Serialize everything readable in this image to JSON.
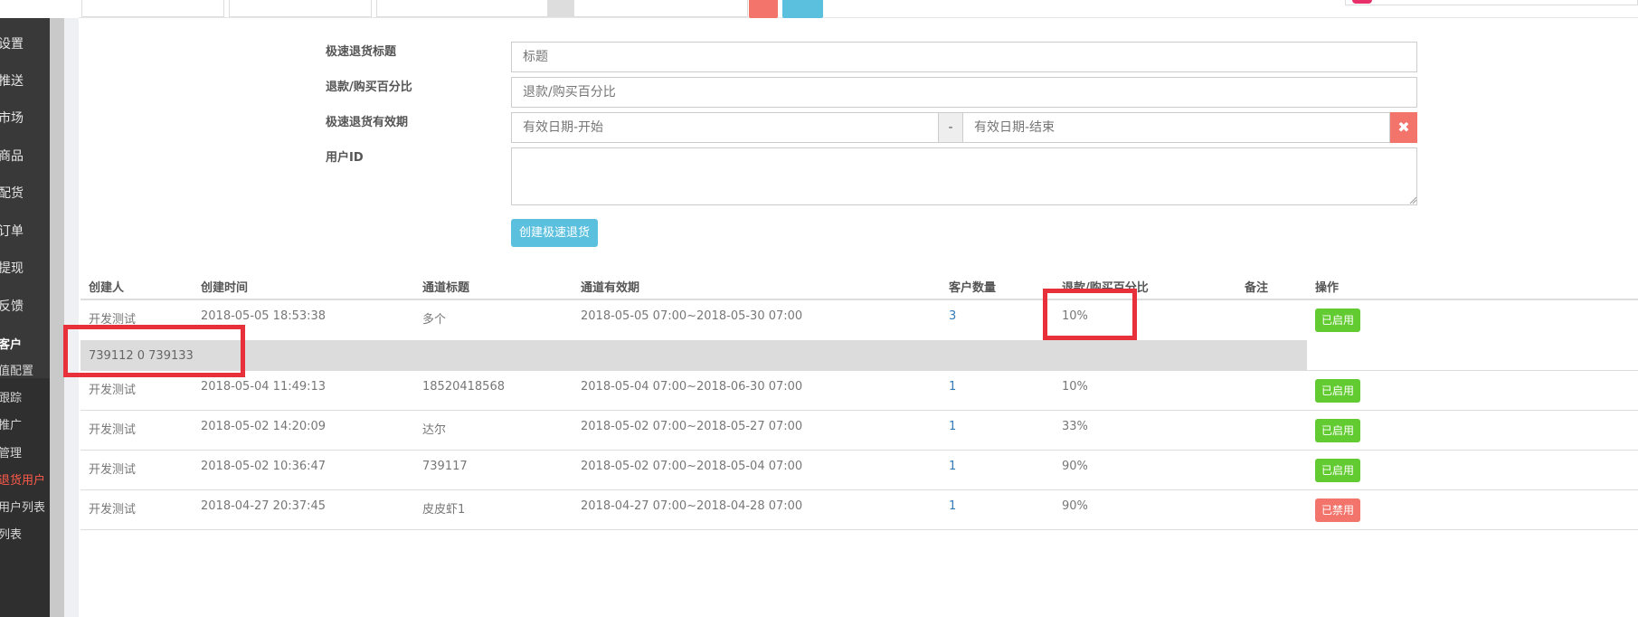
{
  "sidebar": {
    "items": [
      "设置",
      "推送",
      "市场",
      "商品",
      "配货",
      "订单",
      "提现",
      "反馈"
    ],
    "sub_items": [
      {
        "label": "客户",
        "style": "head"
      },
      {
        "label": "值配置",
        "style": "normal"
      },
      {
        "label": "跟踪",
        "style": "normal"
      },
      {
        "label": "推广",
        "style": "normal"
      },
      {
        "label": "管理",
        "style": "normal"
      },
      {
        "label": "退货用户",
        "style": "active"
      },
      {
        "label": "用户列表",
        "style": "normal"
      },
      {
        "label": "列表",
        "style": "normal"
      }
    ]
  },
  "form": {
    "title_label": "极速退货标题",
    "title_placeholder": "标题",
    "percent_label": "退款/购买百分比",
    "percent_placeholder": "退款/购买百分比",
    "validity_label": "极速退货有效期",
    "date_start_placeholder": "有效日期-开始",
    "date_separator": "-",
    "date_end_placeholder": "有效日期-结束",
    "clear_symbol": "✖",
    "user_id_label": "用户ID",
    "create_button": "创建极速退货"
  },
  "table": {
    "headers": {
      "creator": "创建人",
      "created_time": "创建时间",
      "channel_title": "通道标题",
      "channel_validity": "通道有效期",
      "customer_count": "客户数量",
      "percent": "退款/购买百分比",
      "remark": "备注",
      "action": "操作"
    },
    "rows": [
      {
        "creator": "开发测试",
        "created_time": "2018-05-05 18:53:38",
        "title": "多个",
        "validity": "2018-05-05 07:00~2018-05-30 07:00",
        "count": "3",
        "percent": "10%",
        "remark": "",
        "status": "已启用",
        "status_type": "on"
      },
      {
        "creator": "开发测试",
        "created_time": "2018-05-04 11:49:13",
        "title": "18520418568",
        "validity": "2018-05-04 07:00~2018-06-30 07:00",
        "count": "1",
        "percent": "10%",
        "remark": "",
        "status": "已启用",
        "status_type": "on"
      },
      {
        "creator": "开发测试",
        "created_time": "2018-05-02 14:20:09",
        "title": "达尔",
        "validity": "2018-05-02 07:00~2018-05-27 07:00",
        "count": "1",
        "percent": "33%",
        "remark": "",
        "status": "已启用",
        "status_type": "on"
      },
      {
        "creator": "开发测试",
        "created_time": "2018-05-02 10:36:47",
        "title": "739117",
        "validity": "2018-05-02 07:00~2018-05-04 07:00",
        "count": "1",
        "percent": "90%",
        "remark": "",
        "status": "已启用",
        "status_type": "on"
      },
      {
        "creator": "开发测试",
        "created_time": "2018-04-27 20:37:45",
        "title": "皮皮虾1",
        "validity": "2018-04-27 07:00~2018-04-28 07:00",
        "count": "1",
        "percent": "90%",
        "remark": "",
        "status": "已禁用",
        "status_type": "off"
      }
    ],
    "expanded_detail": "739112 0 739133"
  },
  "colors": {
    "enabled": "#62cb31",
    "disabled": "#f2746b",
    "primary": "#5bc0de",
    "annotation": "#e8303a"
  }
}
